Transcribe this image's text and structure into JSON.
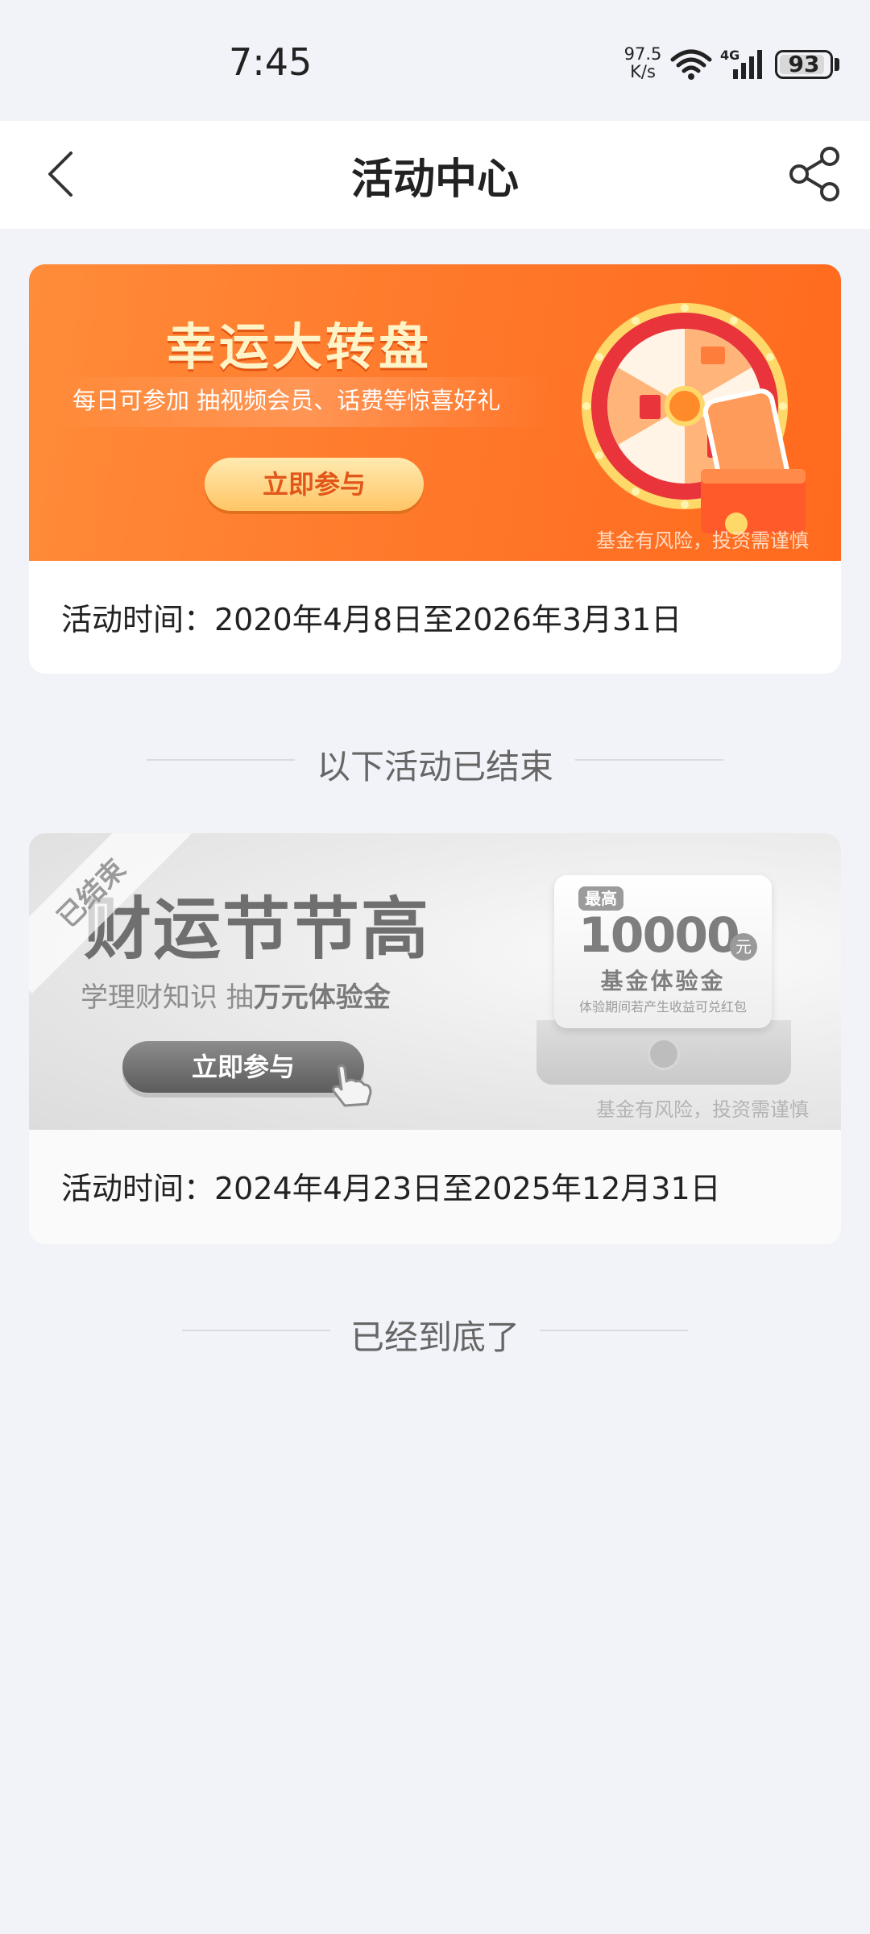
{
  "status_bar": {
    "time": "7:45",
    "net_speed_value": "97.5",
    "net_speed_unit": "K/s",
    "network_type": "4G",
    "battery_percent": "93",
    "battery_level": 0.93
  },
  "nav": {
    "title": "活动中心",
    "back_icon": "chevron-left-icon",
    "share_icon": "share-icon"
  },
  "activities": [
    {
      "banner_title": "幸运大转盘",
      "banner_subtitle": "每日可参加 抽视频会员、话费等惊喜好礼",
      "cta_label": "立即参与",
      "risk_notice": "基金有风险，投资需谨慎",
      "time_text": "活动时间：2020年4月8日至2026年3月31日",
      "status": "active",
      "accent_color": "#ff7a2c"
    },
    {
      "status_tag": "已结束",
      "banner_title": "财运节节高",
      "banner_subtitle_prefix": "学理财知识  抽",
      "banner_subtitle_bold": "万元体验金",
      "cta_label": "立即参与",
      "coupon_tag": "最高",
      "coupon_amount": "10000",
      "coupon_unit": "元",
      "coupon_name": "基金体验金",
      "coupon_note": "体验期间若产生收益可兑红包",
      "risk_notice": "基金有风险，投资需谨慎",
      "time_text": "活动时间：2024年4月23日至2025年12月31日",
      "status": "ended"
    }
  ],
  "ended_divider": "以下活动已结束",
  "bottom_divider": "已经到底了"
}
